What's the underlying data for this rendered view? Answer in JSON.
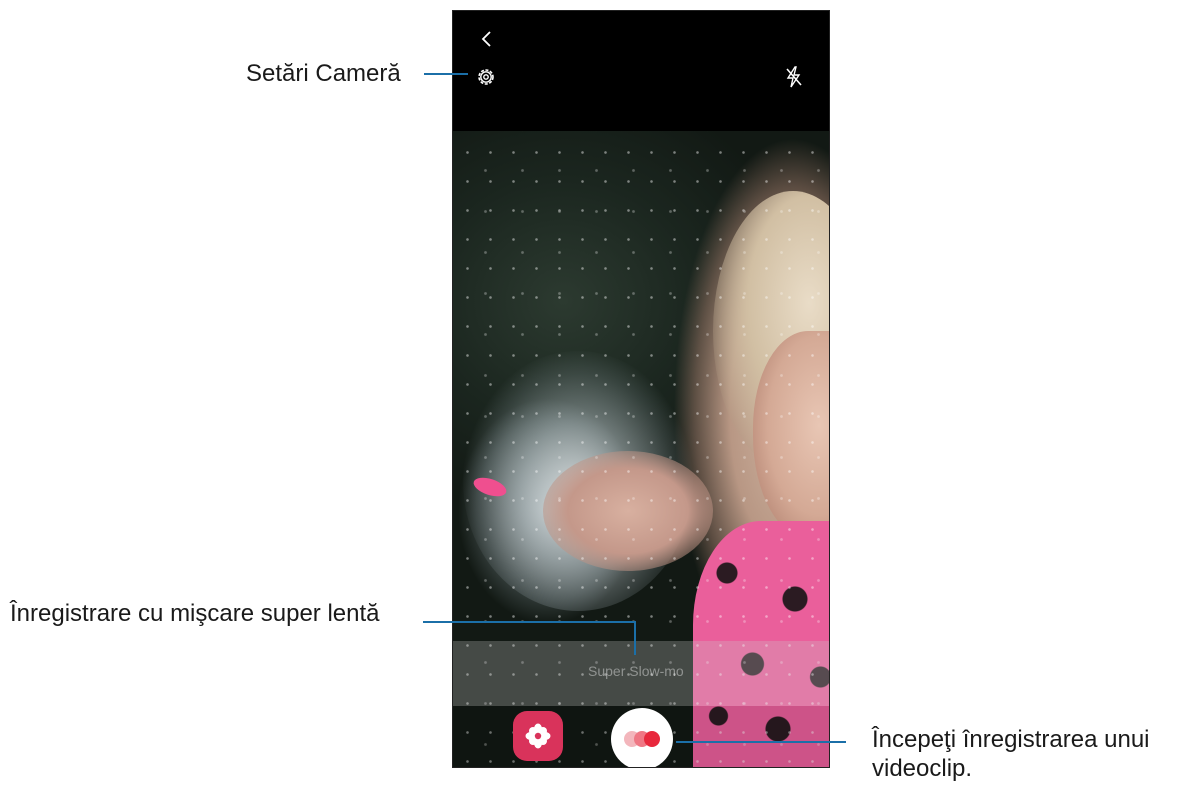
{
  "callouts": {
    "camera_settings": "Setări Cameră",
    "super_slow_mo": "Înregistrare cu mişcare super lentă",
    "start_recording_line1": "Începeţi înregistrarea unui",
    "start_recording_line2": "videoclip."
  },
  "camera_ui": {
    "mode_label": "Super Slow-mo",
    "icons": {
      "back": "back-chevron-icon",
      "settings": "gear-icon",
      "flash": "flash-off-icon",
      "gallery": "gallery-flower-icon",
      "record": "super-slow-mo-record-icon"
    }
  },
  "colors": {
    "leader_line": "#1b6fa8",
    "gallery_button": "#d9335b",
    "record_dot": "#e8283c"
  }
}
